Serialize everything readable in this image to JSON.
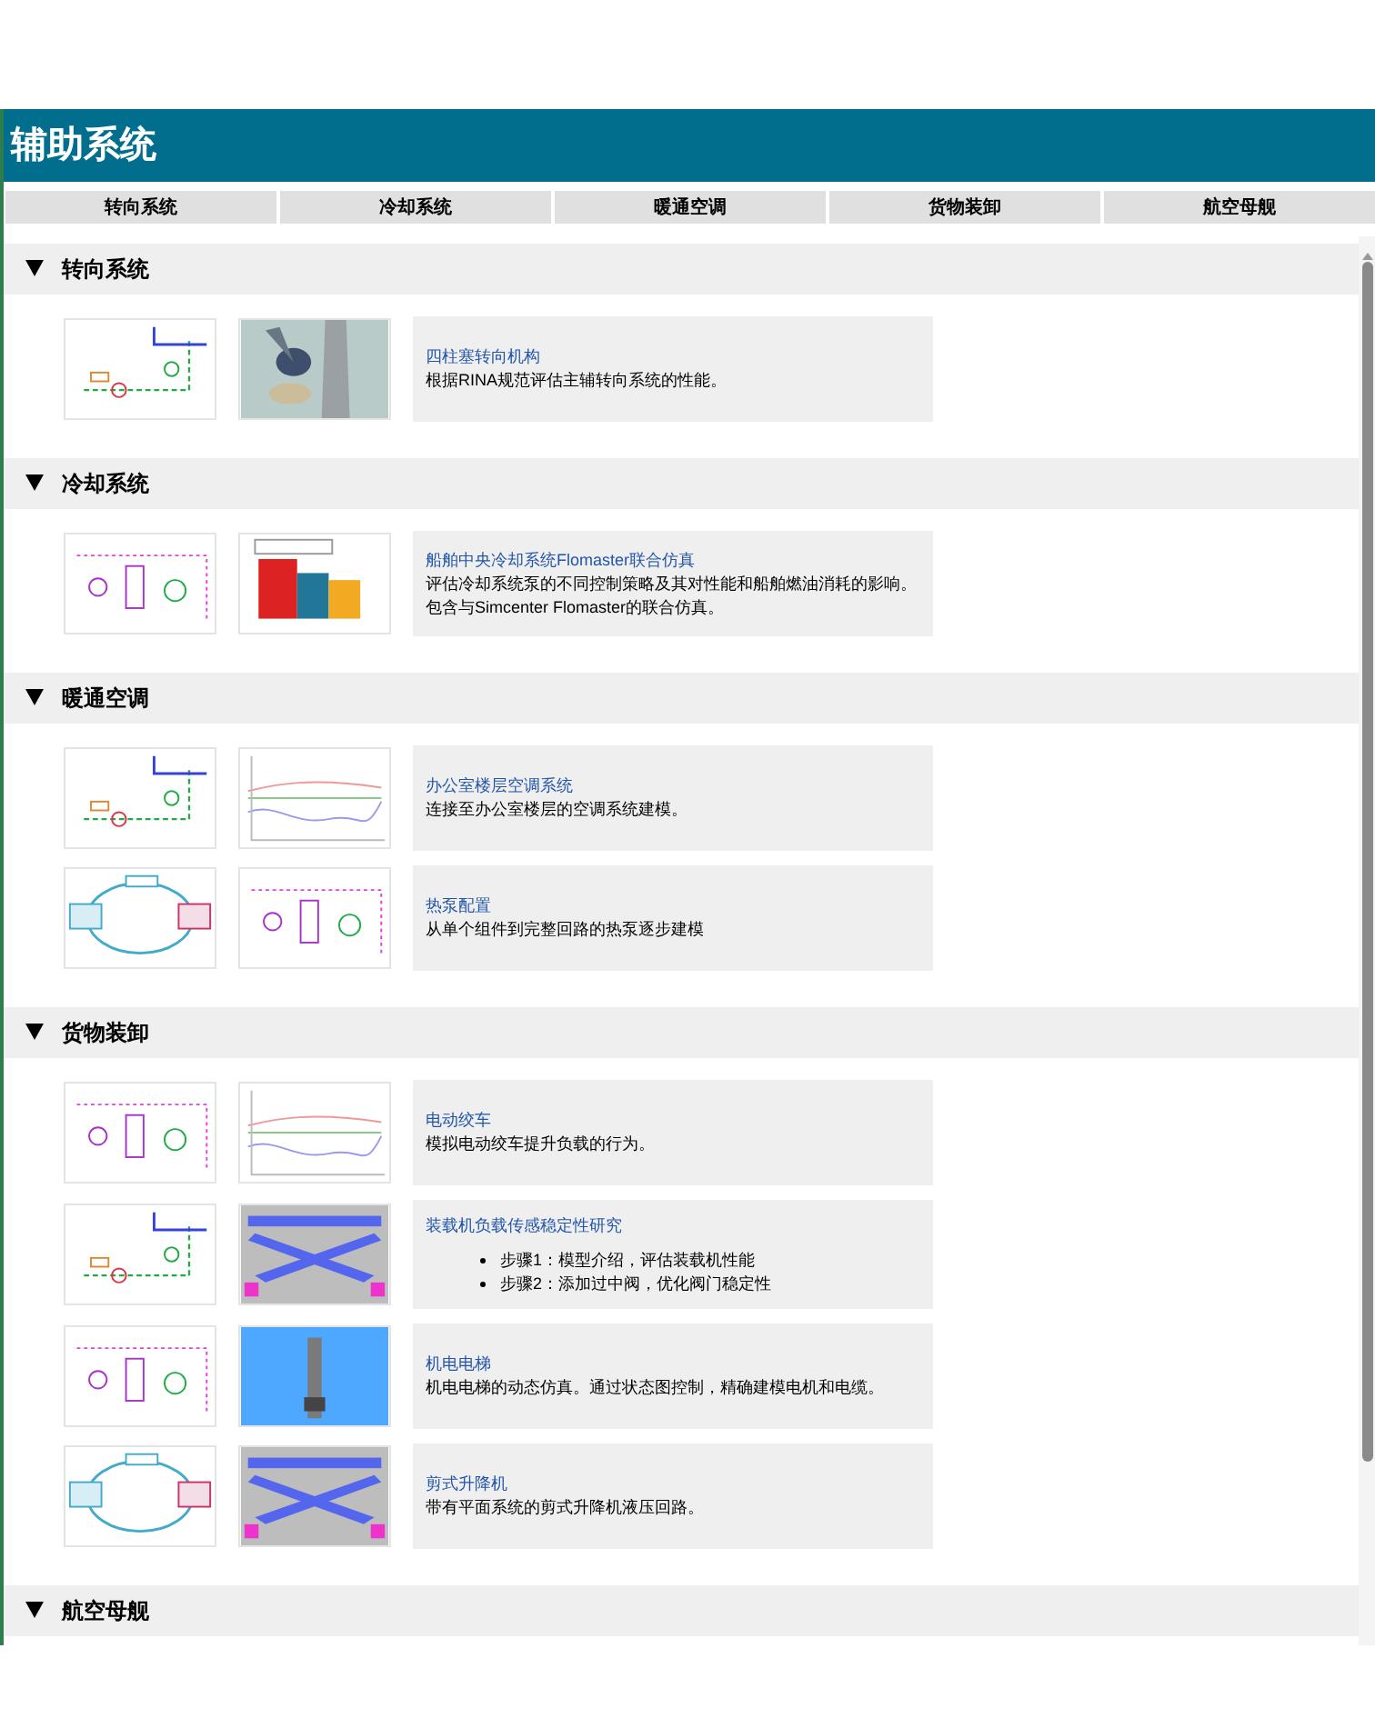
{
  "header": {
    "title": "辅助系统"
  },
  "tabs": [
    {
      "label": "转向系统"
    },
    {
      "label": "冷却系统"
    },
    {
      "label": "暖通空调"
    },
    {
      "label": "货物装卸"
    },
    {
      "label": "航空母舰"
    }
  ],
  "sections": [
    {
      "title": "转向系统",
      "expanded": true,
      "items": [
        {
          "kind": "text",
          "title": "四柱塞转向机构",
          "lines": [
            "根据RINA规范评估主辅转向系统的性能。"
          ]
        }
      ]
    },
    {
      "title": "冷却系统",
      "expanded": true,
      "items": [
        {
          "kind": "text",
          "title": "船舶中央冷却系统Flomaster联合仿真",
          "lines": [
            "评估冷却系统泵的不同控制策略及其对性能和船舶燃油消耗的影响。",
            "包含与Simcenter Flomaster的联合仿真。"
          ]
        }
      ]
    },
    {
      "title": "暖通空调",
      "expanded": true,
      "items": [
        {
          "kind": "text",
          "title": "办公室楼层空调系统",
          "lines": [
            "连接至办公室楼层的空调系统建模。"
          ]
        },
        {
          "kind": "text",
          "title": "热泵配置",
          "lines": [
            "从单个组件到完整回路的热泵逐步建模"
          ]
        }
      ]
    },
    {
      "title": "货物装卸",
      "expanded": true,
      "items": [
        {
          "kind": "text",
          "title": "电动绞车",
          "lines": [
            "模拟电动绞车提升负载的行为。"
          ]
        },
        {
          "kind": "bullets",
          "title": "装载机负载传感稳定性研究",
          "lines": [
            "步骤1：模型介绍，评估装载机性能",
            "步骤2：添加过中阀，优化阀门稳定性"
          ]
        },
        {
          "kind": "text",
          "title": "机电电梯",
          "lines": [
            "机电电梯的动态仿真。通过状态图控制，精确建模电机和电缆。"
          ]
        },
        {
          "kind": "text",
          "title": "剪式升降机",
          "lines": [
            "带有平面系统的剪式升降机液压回路。"
          ]
        }
      ]
    },
    {
      "title": "航空母舰",
      "expanded": true
    }
  ]
}
